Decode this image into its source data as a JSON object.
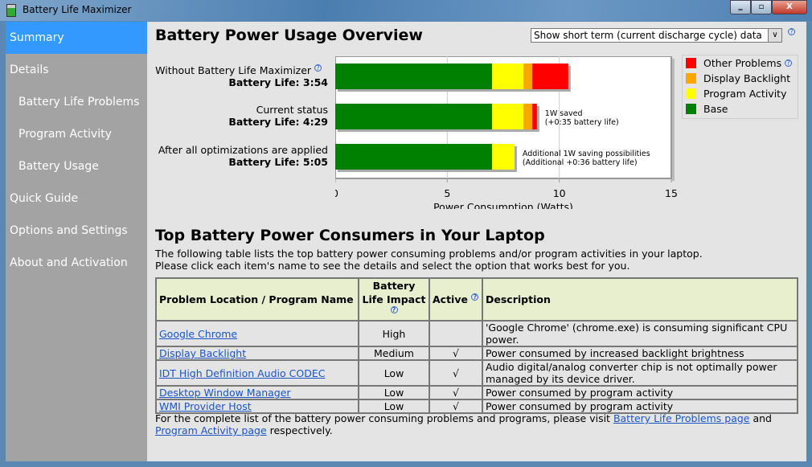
{
  "window": {
    "title": "Battery Life Maximizer",
    "minimize": "‗",
    "maximize": "▫",
    "close": "X"
  },
  "sidebar": {
    "items": [
      {
        "label": "Summary",
        "active": true,
        "sub": false
      },
      {
        "label": "Details",
        "sub": false
      },
      {
        "label": "Battery Life Problems",
        "sub": true
      },
      {
        "label": "Program Activity",
        "sub": true
      },
      {
        "label": "Battery Usage",
        "sub": true
      },
      {
        "label": "Quick Guide",
        "sub": false
      },
      {
        "label": "Options and Settings",
        "sub": false
      },
      {
        "label": "About and Activation",
        "sub": false
      }
    ]
  },
  "overview": {
    "title": "Battery Power Usage Overview",
    "period_select": "Show short term (current discharge cycle) data",
    "help": "?"
  },
  "rows": [
    {
      "label": "Without Battery Life Maximizer",
      "life": "Battery Life: 3:54",
      "note1": "",
      "note2": ""
    },
    {
      "label": "Current status",
      "life": "Battery Life: 4:29",
      "note1": "1W saved",
      "note2": "(+0:35 battery life)"
    },
    {
      "label": "After all optimizations are applied",
      "life": "Battery Life: 5:05",
      "note1": "Additional 1W saving possibilities",
      "note2": "(Additional +0:36 battery life)"
    }
  ],
  "chart_data": {
    "type": "bar",
    "orientation": "horizontal",
    "stacked": true,
    "categories": [
      "Without Battery Life Maximizer",
      "Current status",
      "After all optimizations are applied"
    ],
    "series": [
      {
        "name": "Base",
        "color": "#008000",
        "values": [
          7.0,
          7.0,
          7.0
        ]
      },
      {
        "name": "Program Activity",
        "color": "#ffff00",
        "values": [
          1.4,
          1.4,
          1.0
        ]
      },
      {
        "name": "Display Backlight",
        "color": "#ffa500",
        "values": [
          0.4,
          0.4,
          0
        ]
      },
      {
        "name": "Other Problems",
        "color": "#ff0000",
        "values": [
          1.6,
          0.2,
          0
        ]
      }
    ],
    "xlabel": "Power Consumption (Watts)",
    "xlim": [
      0,
      15
    ],
    "xticks": [
      "0",
      "5",
      "10",
      "15"
    ],
    "grid": true,
    "legend": "right"
  },
  "legend_order": [
    "Other Problems",
    "Display Backlight",
    "Program Activity",
    "Base"
  ],
  "consumers": {
    "title": "Top Battery Power Consumers in Your Laptop",
    "intro1": "The following table lists the top battery power consuming problems and/or program activities in your laptop.",
    "intro2": "Please click each item's name to see the details and select the option that works best for you.",
    "headers": [
      "Problem Location / Program Name",
      "Battery Life Impact",
      "Active",
      "Description"
    ],
    "rows": [
      {
        "name": "Google Chrome",
        "impact": "High",
        "active": "",
        "desc": "'Google Chrome' (chrome.exe) is consuming significant CPU power."
      },
      {
        "name": "Display Backlight",
        "impact": "Medium",
        "active": "√",
        "desc": "Power consumed by increased backlight brightness"
      },
      {
        "name": "IDT High Definition Audio CODEC",
        "impact": "Low",
        "active": "√",
        "desc": "Audio digital/analog converter chip is not optimally power managed by its device driver."
      },
      {
        "name": "Desktop Window Manager",
        "impact": "Low",
        "active": "√",
        "desc": "Power consumed by program activity"
      },
      {
        "name": "WMI Provider Host",
        "impact": "Low",
        "active": "√",
        "desc": "Power consumed by program activity"
      }
    ],
    "footer_pre": "For the complete list of the battery power consuming problems and programs, please visit ",
    "footer_link1": "Battery Life Problems page",
    "footer_mid": " and ",
    "footer_link2": "Program Activity page",
    "footer_post": " respectively."
  }
}
